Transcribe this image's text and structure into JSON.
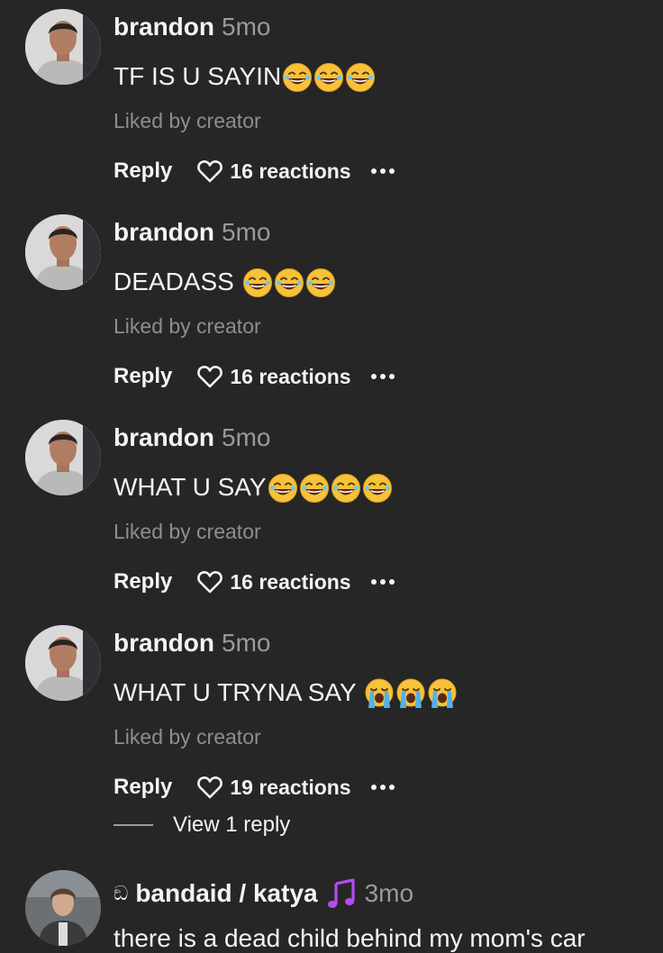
{
  "comments": [
    {
      "username": "brandon",
      "age": "5mo",
      "text": "TF IS U SAYIN",
      "emojis": [
        "laugh",
        "laugh",
        "laugh"
      ],
      "liked": "Liked by creator",
      "reply": "Reply",
      "reactions": "16 reactions"
    },
    {
      "username": "brandon",
      "age": "5mo",
      "text": "DEADASS ",
      "emojis": [
        "laugh",
        "laugh",
        "laugh"
      ],
      "liked": "Liked by creator",
      "reply": "Reply",
      "reactions": "16 reactions"
    },
    {
      "username": "brandon",
      "age": "5mo",
      "text": "WHAT U SAY",
      "emojis": [
        "laugh",
        "laugh",
        "laugh",
        "laugh"
      ],
      "liked": "Liked by creator",
      "reply": "Reply",
      "reactions": "16 reactions"
    },
    {
      "username": "brandon",
      "age": "5mo",
      "text": "WHAT U TRYNA SAY ",
      "emojis": [
        "cry",
        "cry",
        "cry"
      ],
      "liked": "Liked by creator",
      "reply": "Reply",
      "reactions": "19 reactions"
    }
  ],
  "view_replies": "View 1 reply",
  "last_comment": {
    "badge": "ඞ",
    "username": "bandaid / katya",
    "age": "3mo",
    "text": "there is a dead child behind my mom's car"
  },
  "colors": {
    "background": "#262626",
    "muted": "#9a9a9a",
    "note": "#b44cf0"
  }
}
